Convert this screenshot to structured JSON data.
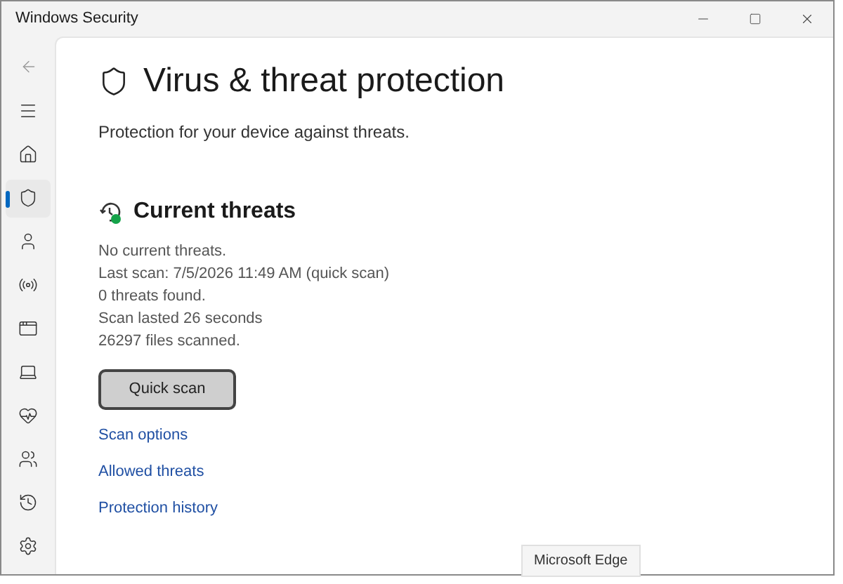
{
  "window": {
    "title": "Windows Security"
  },
  "sidebar": {
    "items": [
      {
        "selected": false
      },
      {
        "selected": true
      },
      {
        "selected": false
      },
      {
        "selected": false
      },
      {
        "selected": false
      },
      {
        "selected": false
      },
      {
        "selected": false
      },
      {
        "selected": false
      },
      {
        "selected": false
      },
      {
        "selected": false
      }
    ]
  },
  "page": {
    "title": "Virus & threat protection",
    "subtitle": "Protection for your device against threats."
  },
  "section": {
    "title": "Current threats",
    "lines": [
      "No current threats.",
      "Last scan: 7/5/2026 11:49 AM (quick scan)",
      "0 threats found.",
      "Scan lasted 26 seconds",
      "26297 files scanned."
    ],
    "button": "Quick scan",
    "links": [
      "Scan options",
      "Allowed threats",
      "Protection history"
    ]
  },
  "tooltip": "Microsoft Edge"
}
